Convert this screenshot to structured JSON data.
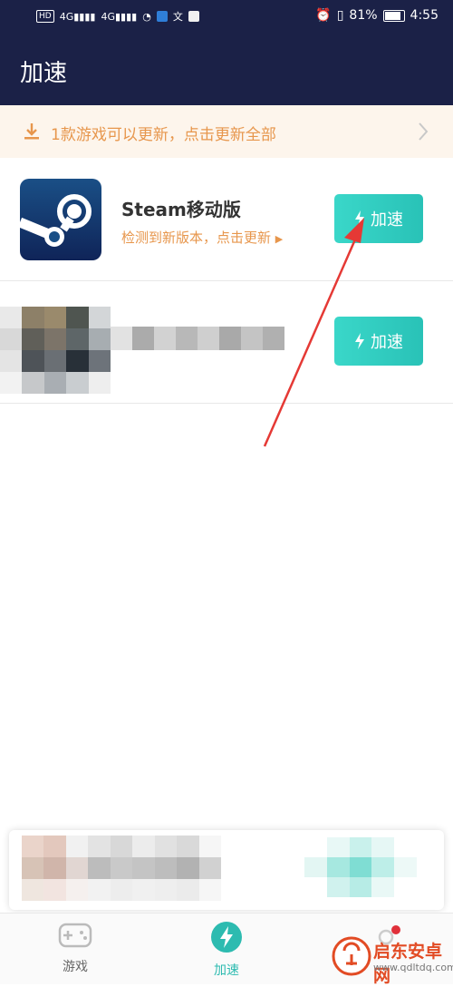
{
  "status_bar": {
    "hd_badge": "HD",
    "network_1": "4G",
    "network_2": "4G",
    "battery_percent": "81%",
    "time": "4:55"
  },
  "header": {
    "title": "加速"
  },
  "update_banner": {
    "text": "1款游戏可以更新，点击更新全部"
  },
  "games": [
    {
      "name": "Steam移动版",
      "subtitle": "检测到新版本，点击更新",
      "button_label": "加速"
    },
    {
      "button_label": "加速"
    }
  ],
  "tabs": [
    {
      "label": "游戏",
      "active": false
    },
    {
      "label": "加速",
      "active": true
    },
    {
      "label": "",
      "active": false
    }
  ],
  "watermark": {
    "name": "启东安卓网",
    "url": "www.qdltdq.com"
  },
  "colors": {
    "header_bg": "#1b2147",
    "accent": "#2dbbb0",
    "orange": "#e7964c",
    "arrow": "#e53935"
  }
}
